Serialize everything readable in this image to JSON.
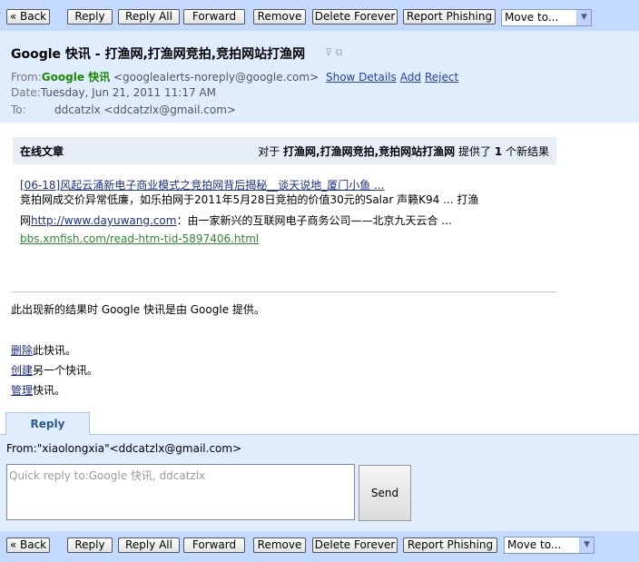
{
  "toolbar": {
    "back": "« Back",
    "reply": "Reply",
    "reply_all": "Reply All",
    "forward": "Forward",
    "remove": "Remove",
    "delete_forever": "Delete Forever",
    "report_phishing": "Report Phishing",
    "move_to": "Move to..."
  },
  "email": {
    "subject": "Google 快讯 - 打渔网,打渔网竞拍,竞拍网站打渔网",
    "from_label": "From:",
    "from_name": "Google 快讯",
    "from_addr": "<googlealerts-noreply@google.com>",
    "show_details": "Show Details",
    "add": "Add",
    "reject": "Reject",
    "date_label": "Date:",
    "date_value": "Tuesday, Jun 21, 2011 11:17 AM",
    "to_label": "To:",
    "to_value": "ddcatzlx <ddcatzlx@gmail.com>"
  },
  "band": {
    "left": "在线文章",
    "right_prefix": "对于 ",
    "right_query": "打渔网,打渔网竞拍,竞拍网站打渔网",
    "right_mid": " 提供了 ",
    "right_count": "1",
    "right_suffix": " 个新结果"
  },
  "article": {
    "link_text": "[06-18]风起云涌新电子商业模式之竞拍网背后揭秘__谈天说地_厦门小鱼 ...",
    "line1": "竞拍网成交价异常低廉，如乐拍网于2011年5月28日竞拍的价值30元的Salar 声籁K94 ... 打渔",
    "line2_prefix": "网",
    "line2_link": "http://www.dayuwang.com",
    "line2_suffix": "：由一家新兴的互联网电子商务公司——北京九天云合 ...",
    "url": "bbs.xmfish.com/read-htm-tid-5897406.html"
  },
  "footer": {
    "note": "此出现新的结果时 Google 快讯是由 Google 提供。",
    "delete_link": "删除",
    "delete_rest": "此快讯。",
    "create_link": "创建",
    "create_rest": "另一个快讯。",
    "manage_link": "管理",
    "manage_rest": "快讯。"
  },
  "reply": {
    "tab": "Reply",
    "from_line": "From:\"xiaolongxia\"<ddcatzlx@gmail.com>",
    "placeholder": "Quick reply to:Google 快讯, ddcatzlx",
    "send": "Send"
  }
}
